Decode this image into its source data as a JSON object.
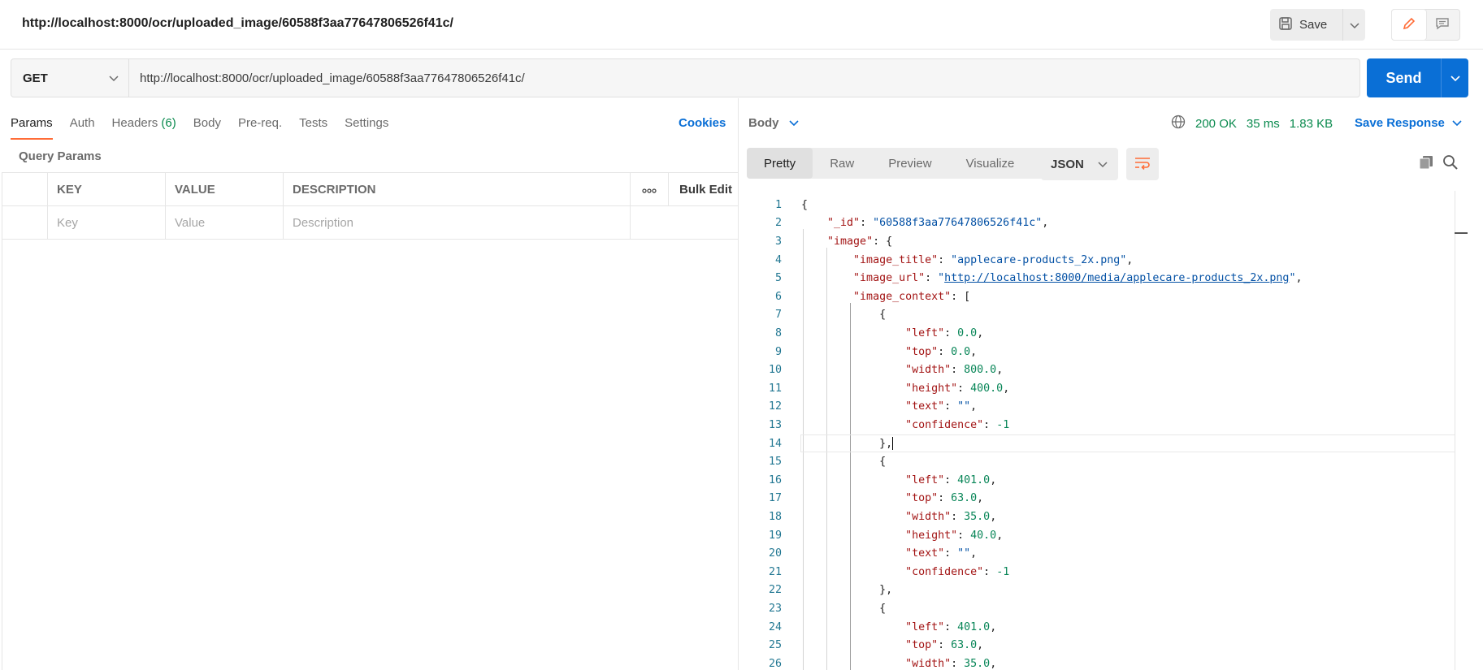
{
  "request": {
    "title": "http://localhost:8000/ocr/uploaded_image/60588f3aa77647806526f41c/",
    "save_label": "Save",
    "method": "GET",
    "url": "http://localhost:8000/ocr/uploaded_image/60588f3aa77647806526f41c/",
    "send_label": "Send"
  },
  "request_tabs": {
    "params": "Params",
    "auth": "Auth",
    "headers": "Headers",
    "headers_count": "(6)",
    "body": "Body",
    "prereq": "Pre-req.",
    "tests": "Tests",
    "settings": "Settings",
    "cookies": "Cookies"
  },
  "query_params": {
    "title": "Query Params",
    "headers": {
      "key": "KEY",
      "value": "VALUE",
      "description": "DESCRIPTION",
      "bulk_edit": "Bulk Edit"
    },
    "placeholders": {
      "key": "Key",
      "value": "Value",
      "description": "Description"
    }
  },
  "response": {
    "section": "Body",
    "status": "200 OK",
    "time": "35 ms",
    "size": "1.83 KB",
    "save_response": "Save Response",
    "view_tabs": [
      "Pretty",
      "Raw",
      "Preview",
      "Visualize"
    ],
    "format": "JSON"
  },
  "colors": {
    "accent_orange": "#ff6c37",
    "send_blue": "#0a6fd6",
    "status_green": "#0a8a4e"
  },
  "code_lines": [
    [
      [
        "p",
        "{"
      ]
    ],
    [
      [
        "p",
        "    "
      ],
      [
        "k",
        "\"_id\""
      ],
      [
        "p",
        ": "
      ],
      [
        "s",
        "\"60588f3aa77647806526f41c\""
      ],
      [
        "p",
        ","
      ]
    ],
    [
      [
        "p",
        "    "
      ],
      [
        "k",
        "\"image\""
      ],
      [
        "p",
        ": {"
      ]
    ],
    [
      [
        "p",
        "        "
      ],
      [
        "k",
        "\"image_title\""
      ],
      [
        "p",
        ": "
      ],
      [
        "s",
        "\"applecare-products_2x.png\""
      ],
      [
        "p",
        ","
      ]
    ],
    [
      [
        "p",
        "        "
      ],
      [
        "k",
        "\"image_url\""
      ],
      [
        "p",
        ": "
      ],
      [
        "s",
        "\""
      ],
      [
        "u",
        "http://localhost:8000/media/applecare-products_2x.png"
      ],
      [
        "s",
        "\""
      ],
      [
        "p",
        ","
      ]
    ],
    [
      [
        "p",
        "        "
      ],
      [
        "k",
        "\"image_context\""
      ],
      [
        "p",
        ": ["
      ]
    ],
    [
      [
        "p",
        "            {"
      ]
    ],
    [
      [
        "p",
        "                "
      ],
      [
        "k",
        "\"left\""
      ],
      [
        "p",
        ": "
      ],
      [
        "n",
        "0.0"
      ],
      [
        "p",
        ","
      ]
    ],
    [
      [
        "p",
        "                "
      ],
      [
        "k",
        "\"top\""
      ],
      [
        "p",
        ": "
      ],
      [
        "n",
        "0.0"
      ],
      [
        "p",
        ","
      ]
    ],
    [
      [
        "p",
        "                "
      ],
      [
        "k",
        "\"width\""
      ],
      [
        "p",
        ": "
      ],
      [
        "n",
        "800.0"
      ],
      [
        "p",
        ","
      ]
    ],
    [
      [
        "p",
        "                "
      ],
      [
        "k",
        "\"height\""
      ],
      [
        "p",
        ": "
      ],
      [
        "n",
        "400.0"
      ],
      [
        "p",
        ","
      ]
    ],
    [
      [
        "p",
        "                "
      ],
      [
        "k",
        "\"text\""
      ],
      [
        "p",
        ": "
      ],
      [
        "s",
        "\"\""
      ],
      [
        "p",
        ","
      ]
    ],
    [
      [
        "p",
        "                "
      ],
      [
        "k",
        "\"confidence\""
      ],
      [
        "p",
        ": "
      ],
      [
        "n",
        "-1"
      ]
    ],
    [
      [
        "p",
        "            },"
      ]
    ],
    [
      [
        "p",
        "            {"
      ]
    ],
    [
      [
        "p",
        "                "
      ],
      [
        "k",
        "\"left\""
      ],
      [
        "p",
        ": "
      ],
      [
        "n",
        "401.0"
      ],
      [
        "p",
        ","
      ]
    ],
    [
      [
        "p",
        "                "
      ],
      [
        "k",
        "\"top\""
      ],
      [
        "p",
        ": "
      ],
      [
        "n",
        "63.0"
      ],
      [
        "p",
        ","
      ]
    ],
    [
      [
        "p",
        "                "
      ],
      [
        "k",
        "\"width\""
      ],
      [
        "p",
        ": "
      ],
      [
        "n",
        "35.0"
      ],
      [
        "p",
        ","
      ]
    ],
    [
      [
        "p",
        "                "
      ],
      [
        "k",
        "\"height\""
      ],
      [
        "p",
        ": "
      ],
      [
        "n",
        "40.0"
      ],
      [
        "p",
        ","
      ]
    ],
    [
      [
        "p",
        "                "
      ],
      [
        "k",
        "\"text\""
      ],
      [
        "p",
        ": "
      ],
      [
        "s",
        "\"\""
      ],
      [
        "p",
        ","
      ]
    ],
    [
      [
        "p",
        "                "
      ],
      [
        "k",
        "\"confidence\""
      ],
      [
        "p",
        ": "
      ],
      [
        "n",
        "-1"
      ]
    ],
    [
      [
        "p",
        "            },"
      ]
    ],
    [
      [
        "p",
        "            {"
      ]
    ],
    [
      [
        "p",
        "                "
      ],
      [
        "k",
        "\"left\""
      ],
      [
        "p",
        ": "
      ],
      [
        "n",
        "401.0"
      ],
      [
        "p",
        ","
      ]
    ],
    [
      [
        "p",
        "                "
      ],
      [
        "k",
        "\"top\""
      ],
      [
        "p",
        ": "
      ],
      [
        "n",
        "63.0"
      ],
      [
        "p",
        ","
      ]
    ],
    [
      [
        "p",
        "                "
      ],
      [
        "k",
        "\"width\""
      ],
      [
        "p",
        ": "
      ],
      [
        "n",
        "35.0"
      ],
      [
        "p",
        ","
      ]
    ]
  ]
}
